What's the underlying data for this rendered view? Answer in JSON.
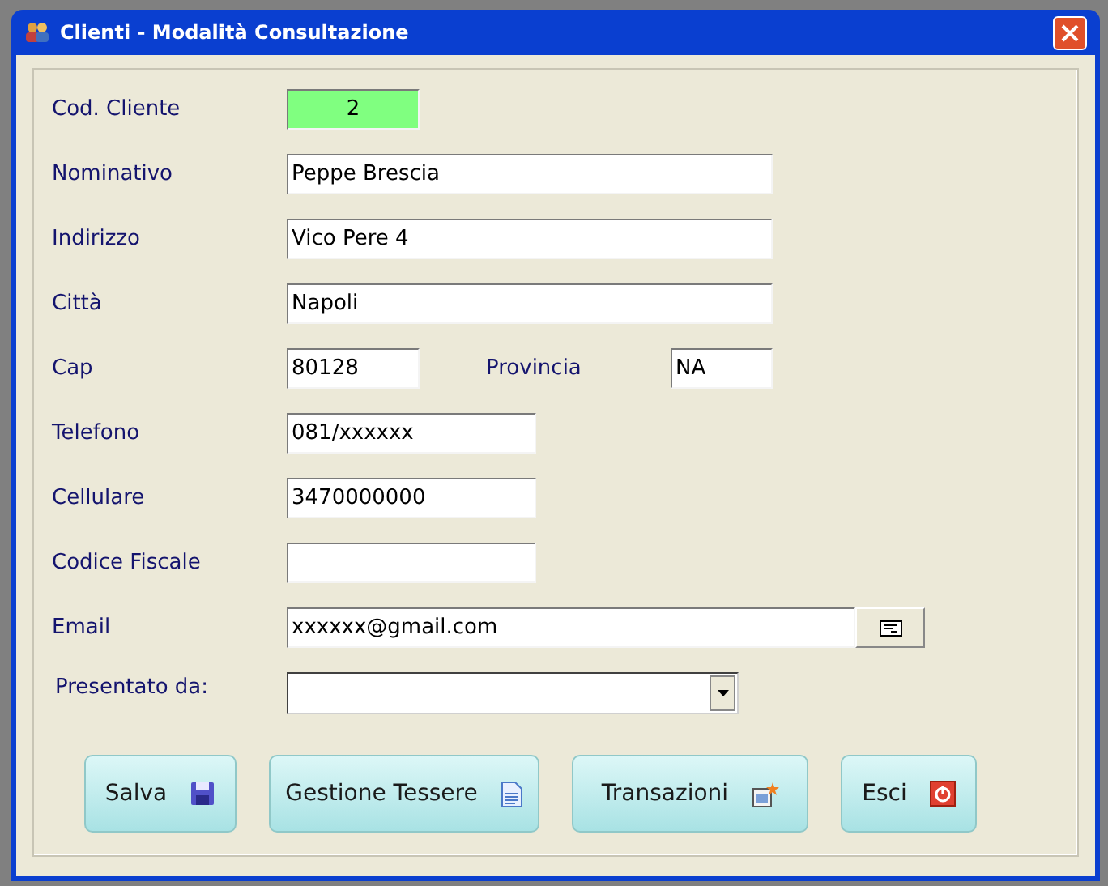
{
  "window": {
    "title": "Clienti - Modalità Consultazione"
  },
  "rows": [
    {
      "label": "Cod. Cliente",
      "value": "2",
      "kind": "code"
    },
    {
      "label": "Nominativo",
      "value": "Peppe Brescia",
      "kind": "long"
    },
    {
      "label": "Indirizzo",
      "value": "Vico Pere 4",
      "kind": "long"
    },
    {
      "label": "Città",
      "value": "Napoli",
      "kind": "long"
    },
    {
      "label": "Cap",
      "value": "80128",
      "kind": "short",
      "extra": {
        "label": "Provincia",
        "value": "NA"
      }
    },
    {
      "label": "Telefono",
      "value": "081/xxxxxx",
      "kind": "medium"
    },
    {
      "label": "Cellulare",
      "value": "3470000000",
      "kind": "medium"
    },
    {
      "label": "Codice Fiscale",
      "kind": "medium"
    },
    {
      "label": "Email",
      "value": "xxxxxx@gmail.com",
      "kind": "email"
    },
    {
      "label": "Presentato da:",
      "kind": "select"
    }
  ],
  "buttons": [
    {
      "label": "Salva",
      "kind": "save"
    },
    {
      "label": "Gestione Tessere",
      "kind": "doc"
    },
    {
      "label": "Transazioni",
      "kind": "trans"
    },
    {
      "label": "Esci",
      "kind": "exit"
    }
  ]
}
